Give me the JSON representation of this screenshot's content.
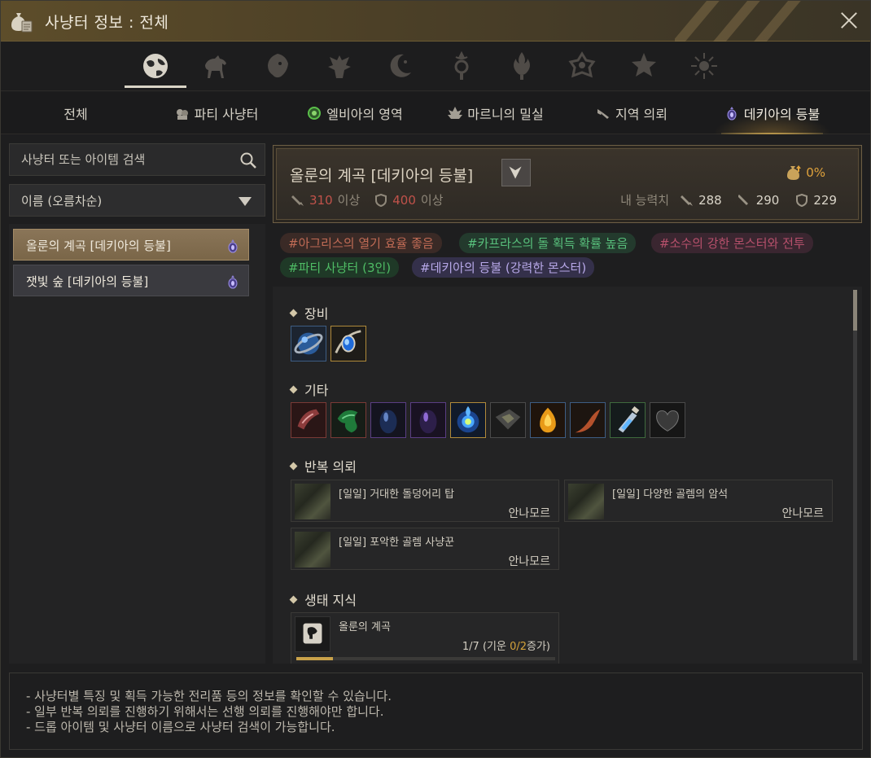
{
  "window": {
    "title": "사냥터 정보 : 전체"
  },
  "categories": [
    {
      "name": "globe-icon",
      "active": true
    },
    {
      "name": "horse-icon",
      "active": false
    },
    {
      "name": "lion-icon",
      "active": false
    },
    {
      "name": "eagle-icon",
      "active": false
    },
    {
      "name": "moon-icon",
      "active": false
    },
    {
      "name": "crest-icon",
      "active": false
    },
    {
      "name": "flame-icon",
      "active": false
    },
    {
      "name": "sun-ornament-icon",
      "active": false
    },
    {
      "name": "star-icon",
      "active": false
    },
    {
      "name": "sunburst-icon",
      "active": false
    }
  ],
  "tabs": [
    {
      "label": "전체",
      "icon": "",
      "active": false
    },
    {
      "label": "파티 사냥터",
      "icon": "party-icon",
      "active": false
    },
    {
      "label": "엘비아의 영역",
      "icon": "elvia-icon",
      "active": false
    },
    {
      "label": "마르니의 밀실",
      "icon": "marni-icon",
      "active": false
    },
    {
      "label": "지역 의뢰",
      "icon": "quest-icon",
      "active": false
    },
    {
      "label": "데키아의 등불",
      "icon": "lantern-icon",
      "active": true
    }
  ],
  "search": {
    "placeholder": "사냥터 또는 아이템 검색",
    "value": ""
  },
  "sort": {
    "label": "이름 (오름차순)"
  },
  "list": [
    {
      "label": "올룬의 계곡 [데키아의 등불]",
      "selected": true
    },
    {
      "label": "잿빛 숲 [데키아의 등불]",
      "selected": false
    }
  ],
  "banner": {
    "name": "올룬의 계곡 [데키아의 등불]",
    "req_ap": "310",
    "req_ap_suffix": "이상",
    "req_dp": "400",
    "req_dp_suffix": "이상",
    "my_label": "내 능력치",
    "my_ap": "288",
    "my_aap": "290",
    "my_dp": "229",
    "drop_rate": "0%",
    "accent": "#e0a33c",
    "warn": "#c0524a"
  },
  "tags": [
    "#아그리스의 열기 효율 좋음",
    "#카프라스의 돌 획득 확률 높음",
    "#소수의 강한 몬스터와 전투",
    "#파티 사냥터 (3인)",
    "#데키아의 등불 (강력한 몬스터)"
  ],
  "sections": {
    "equipment": "장비",
    "etc": "기타",
    "repeat_quests": "반복 의뢰",
    "eco_knowledge": "생태 지식"
  },
  "equipment_items": [
    {
      "icon": "orb-ring-icon"
    },
    {
      "icon": "blue-gem-necklace-icon"
    }
  ],
  "etc_items": [
    {
      "icon": "red-scroll-icon"
    },
    {
      "icon": "green-cloth-icon"
    },
    {
      "icon": "dark-blue-stone-icon"
    },
    {
      "icon": "dark-purple-stone-icon"
    },
    {
      "icon": "blue-flame-icon"
    },
    {
      "icon": "ore-box-icon"
    },
    {
      "icon": "fire-crystal-icon"
    },
    {
      "icon": "red-horn-icon"
    },
    {
      "icon": "potion-vial-icon"
    },
    {
      "icon": "dark-heart-icon"
    }
  ],
  "quests": [
    {
      "title": "[일일] 거대한 돌덩어리 탑",
      "location": "안나모르"
    },
    {
      "title": "[일일] 다양한 골렘의 암석",
      "location": "안나모르"
    },
    {
      "title": "[일일] 포악한 골렘 사냥꾼",
      "location": "안나모르"
    }
  ],
  "eco": {
    "title": "올룬의 계곡",
    "progress_prefix": "1/7 (기운 ",
    "progress_highlight": "0/2",
    "progress_suffix": "증가)",
    "fill_fraction": 0.14
  },
  "footer": [
    "- 사냥터별 특징 및 획득 가능한 전리품 등의 정보를 확인할 수 있습니다.",
    "- 일부 반복 의뢰를 진행하기 위해서는 선행 의뢰를 진행해야만 합니다.",
    "- 드롭 아이템 및 사냥터 이름으로 사냥터 검색이 가능합니다."
  ]
}
